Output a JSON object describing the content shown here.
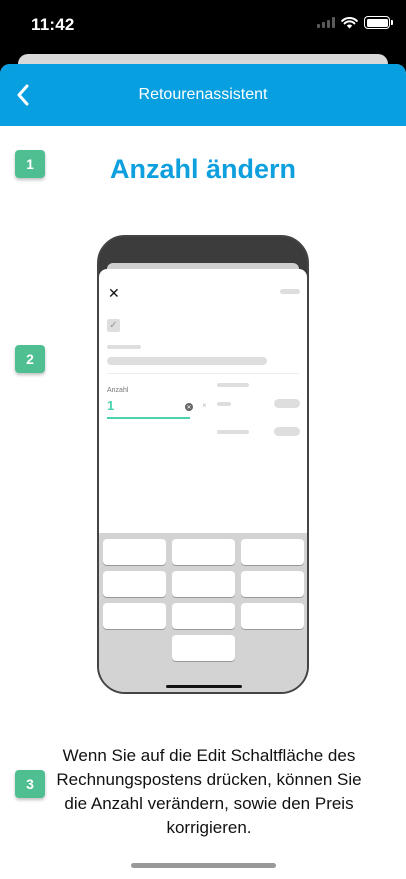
{
  "status_bar": {
    "time": "11:42"
  },
  "nav": {
    "title": "Retourenassistent",
    "back_icon": "chevron-left-icon"
  },
  "badges": [
    "1",
    "2",
    "3"
  ],
  "heading": "Anzahl ändern",
  "illustration": {
    "field_label": "Anzahl",
    "field_value": "1",
    "close_glyph": "✕",
    "times_glyph": "×"
  },
  "description": "Wenn Sie auf die Edit Schaltfläche des Rechnungspostens drücken, können Sie die Anzahl verändern, sowie den Preis korrigieren.",
  "colors": {
    "nav": "#079fe0",
    "heading": "#0e9fdf",
    "badge": "#4fbf92",
    "accent": "#4bd1b0"
  }
}
